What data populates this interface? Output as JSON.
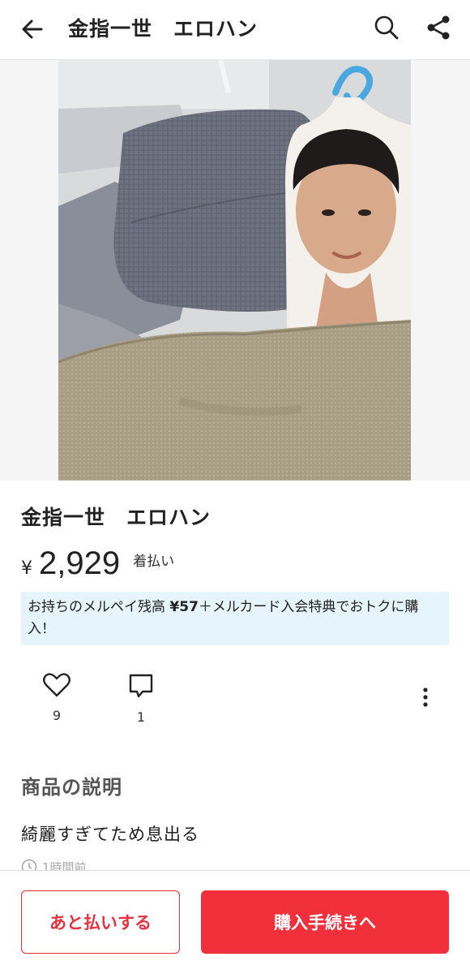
{
  "header": {
    "title": "金指一世　エロハン",
    "back_icon": "arrow-left-icon",
    "search_icon": "search-icon",
    "share_icon": "share-icon"
  },
  "item": {
    "photo_alt": "photo",
    "title": "金指一世　エロハン",
    "currency": "¥",
    "price": "2,929",
    "shipping": "着払い",
    "promo_prefix": "お持ちのメルペイ残高 ",
    "promo_amount": "¥57",
    "promo_suffix": "＋メルカード入会特典でおトクに購入！"
  },
  "actions": {
    "likes": "9",
    "comments": "1"
  },
  "description": {
    "heading": "商品の説明",
    "text": "綺麗すぎてため息出る",
    "posted": "1時間前"
  },
  "bottom": {
    "later_label": "あと払いする",
    "buy_label": "購入手続きへ"
  },
  "colors": {
    "accent": "#f2303c",
    "promo_bg": "#e6f4fb"
  }
}
